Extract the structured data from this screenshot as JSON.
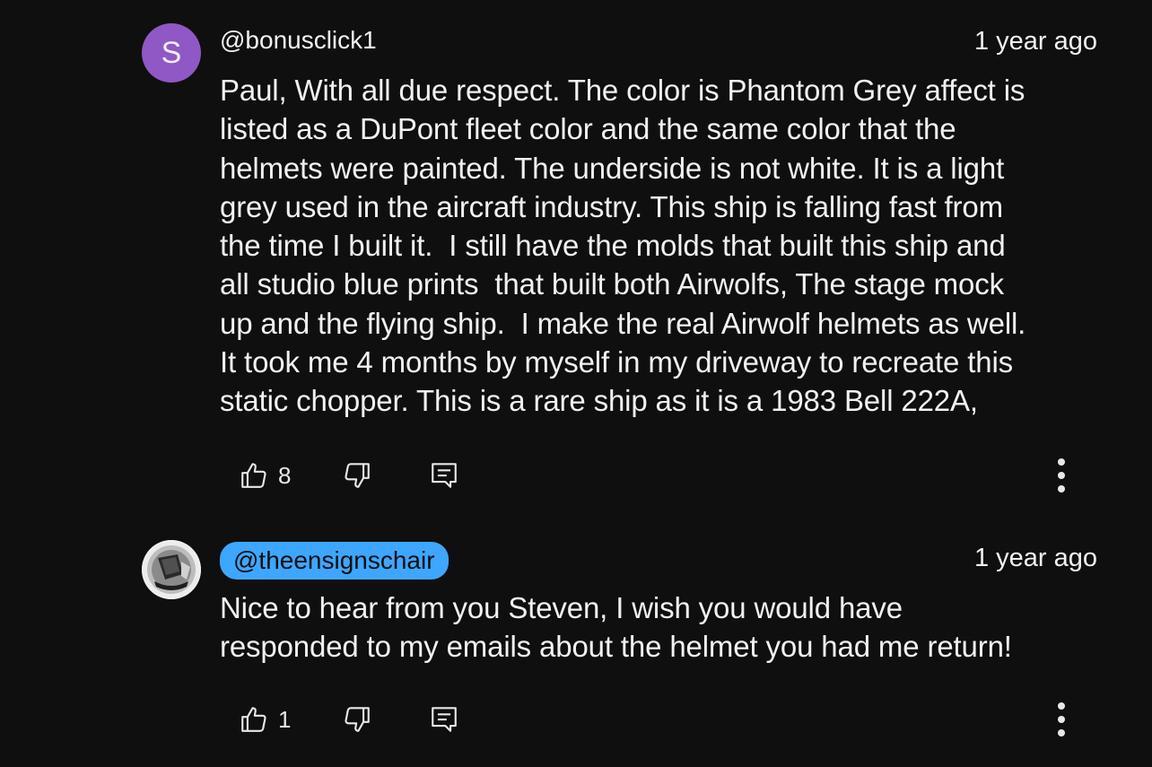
{
  "comments": [
    {
      "avatar_letter": "S",
      "avatar_color": "#8f58c4",
      "handle": "@bonusclick1",
      "time": "1 year ago",
      "lines": [
        "Paul, With all due respect. The color is Phantom Grey affect is",
        "listed as a DuPont fleet color and the same color that the",
        "helmets were painted. The underside is not white. It is a light",
        "grey used in the aircraft industry. This ship is falling fast from",
        "the time I built it.  I still have the molds that built this ship and",
        "all studio blue prints  that built both Airwolfs, The stage mock",
        "up and the flying ship.  I make the real Airwolf helmets as well.",
        "It took me 4 months by myself in my driveway to recreate this",
        "static chopper. This is a rare ship as it is a 1983 Bell 222A,"
      ],
      "likes": "8",
      "icons": {
        "like": "thumbs-up-icon",
        "dislike": "thumbs-down-icon",
        "reply": "reply-icon",
        "more": "more-vert-icon"
      }
    },
    {
      "avatar_image": "chair-photo",
      "handle": "@theensignschair",
      "handle_highlight_color": "#3ea6ff",
      "time": "1 year ago",
      "lines": [
        "Nice to hear from you Steven, I wish you would have",
        "responded to my emails about the helmet you had me return!"
      ],
      "likes": "1",
      "icons": {
        "like": "thumbs-up-icon",
        "dislike": "thumbs-down-icon",
        "reply": "reply-icon",
        "more": "more-vert-icon"
      }
    }
  ]
}
